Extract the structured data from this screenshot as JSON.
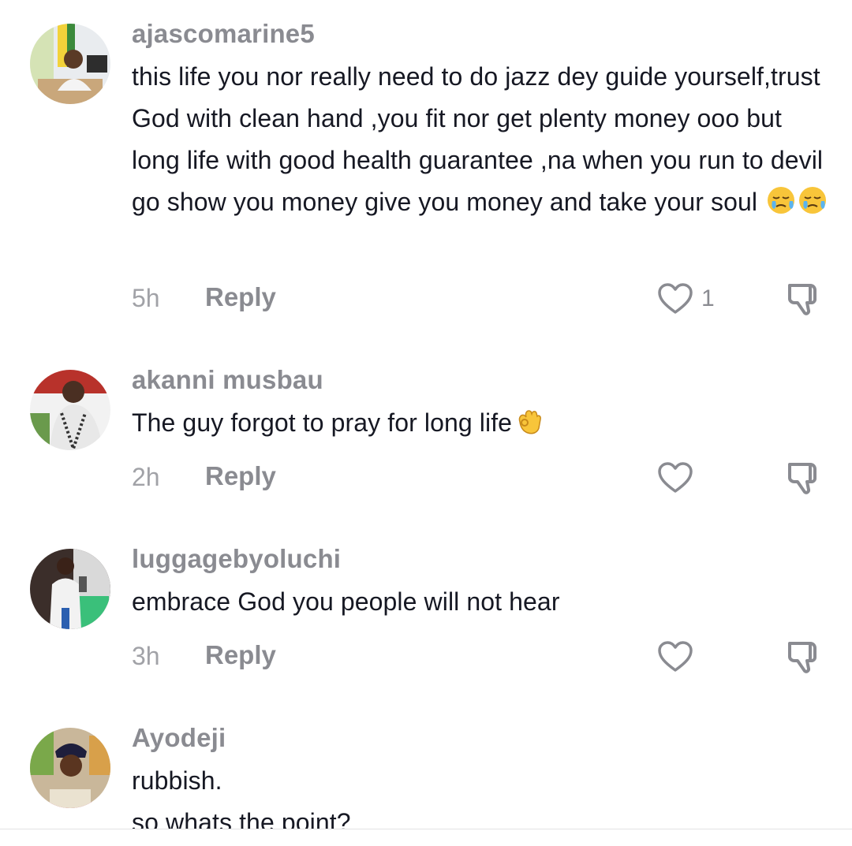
{
  "comments": [
    {
      "username": "ajascomarine5",
      "text": "this life you nor really need to do jazz dey guide yourself,trust God with clean hand ,you fit nor get plenty money ooo but long life with good health guarantee ,na when you run to devil go show you money give you money and take your soul",
      "emoji": "crying-face-emoji",
      "time": "5h",
      "reply_label": "Reply",
      "likes": "1"
    },
    {
      "username": "akanni musbau",
      "text": "The guy forgot to pray for long life",
      "emoji": "ok-hand-emoji",
      "time": "2h",
      "reply_label": "Reply",
      "likes": ""
    },
    {
      "username": "luggagebyoluchi",
      "text": "embrace God you people will not hear",
      "time": "3h",
      "reply_label": "Reply",
      "likes": ""
    },
    {
      "username": "Ayodeji",
      "text_line1": "rubbish.",
      "text_line2": "so whats the point?"
    }
  ],
  "colors": {
    "username": "#8a8b91",
    "body_text": "#161823",
    "meta": "#a1a2a7",
    "icon_stroke": "#8a8b91"
  }
}
